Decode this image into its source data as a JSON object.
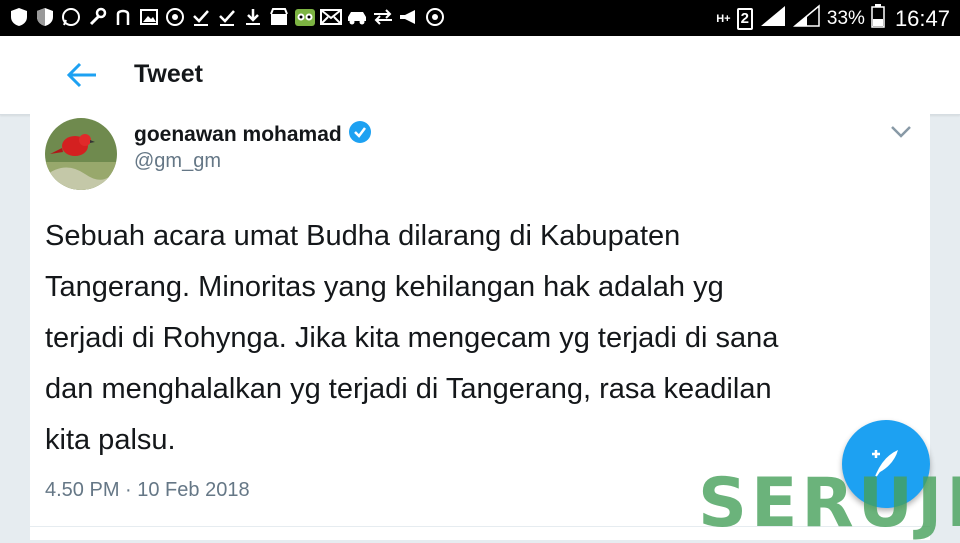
{
  "status_bar": {
    "network_type": "H+",
    "sim_slot": "2",
    "battery_percent": "33%",
    "time": "16:47",
    "notification_icons": [
      "shield-icon",
      "shield-icon",
      "whatsapp-icon",
      "wrench-icon",
      "n-icon",
      "image-icon",
      "chrome-icon",
      "checkmark-icon",
      "checkmark-icon",
      "download-icon",
      "store-icon",
      "owl-icon",
      "mail-icon",
      "car-icon",
      "transfer-icon",
      "megaphone-icon",
      "chrome-icon"
    ]
  },
  "app_bar": {
    "title": "Tweet"
  },
  "tweet": {
    "author_name": "goenawan mohamad",
    "author_handle": "@gm_gm",
    "verified": true,
    "text_lines": [
      "Sebuah acara umat Budha dilarang di Kabupaten",
      "Tangerang.  Minoritas yang kehilangan hak adalah yg",
      "terjadi di Rohynga. Jika kita mengecam yg terjadi di sana",
      "dan menghalalkan yg terjadi di Tangerang, rasa keadilan",
      "kita palsu."
    ],
    "timestamp": "4.50 PM · 10 Feb 2018"
  },
  "watermark": "SERUJI",
  "colors": {
    "accent": "#1da1f2",
    "status_bar": "#000000",
    "watermark": "#46a05a"
  }
}
